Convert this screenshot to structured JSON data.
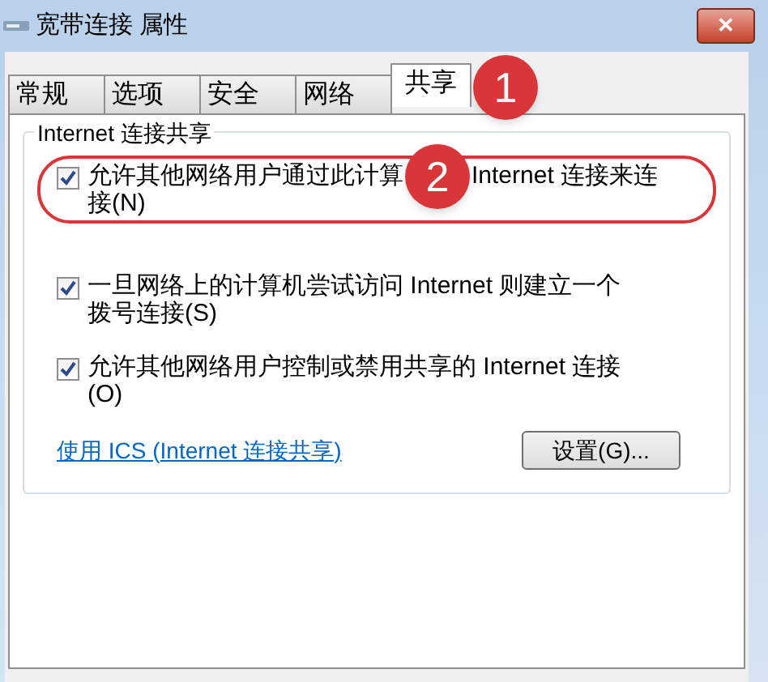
{
  "window": {
    "title": "宽带连接 属性",
    "close": "✕"
  },
  "tabs": [
    {
      "label": "常规",
      "selected": false
    },
    {
      "label": "选项",
      "selected": false
    },
    {
      "label": "安全",
      "selected": false
    },
    {
      "label": "网络",
      "selected": false
    },
    {
      "label": "共享",
      "selected": true,
      "annotation": "1"
    }
  ],
  "group": {
    "title": "Internet 连接共享",
    "options": [
      {
        "label_parts": [
          "允许其他网络用户通过此计算",
          "Internet 连接来连",
          "接(N)"
        ],
        "checked": true,
        "annotation": "2"
      },
      {
        "label_parts": [
          "一旦网络上的计算机尝试访问 Internet 则建立一个拨号连接(S)"
        ],
        "checked": true
      },
      {
        "label_parts": [
          "允许其他网络用户控制或禁用共享的 Internet 连接(O)"
        ],
        "checked": true
      }
    ],
    "link": "使用 ICS (Internet 连接共享)",
    "button": "设置(G)..."
  }
}
